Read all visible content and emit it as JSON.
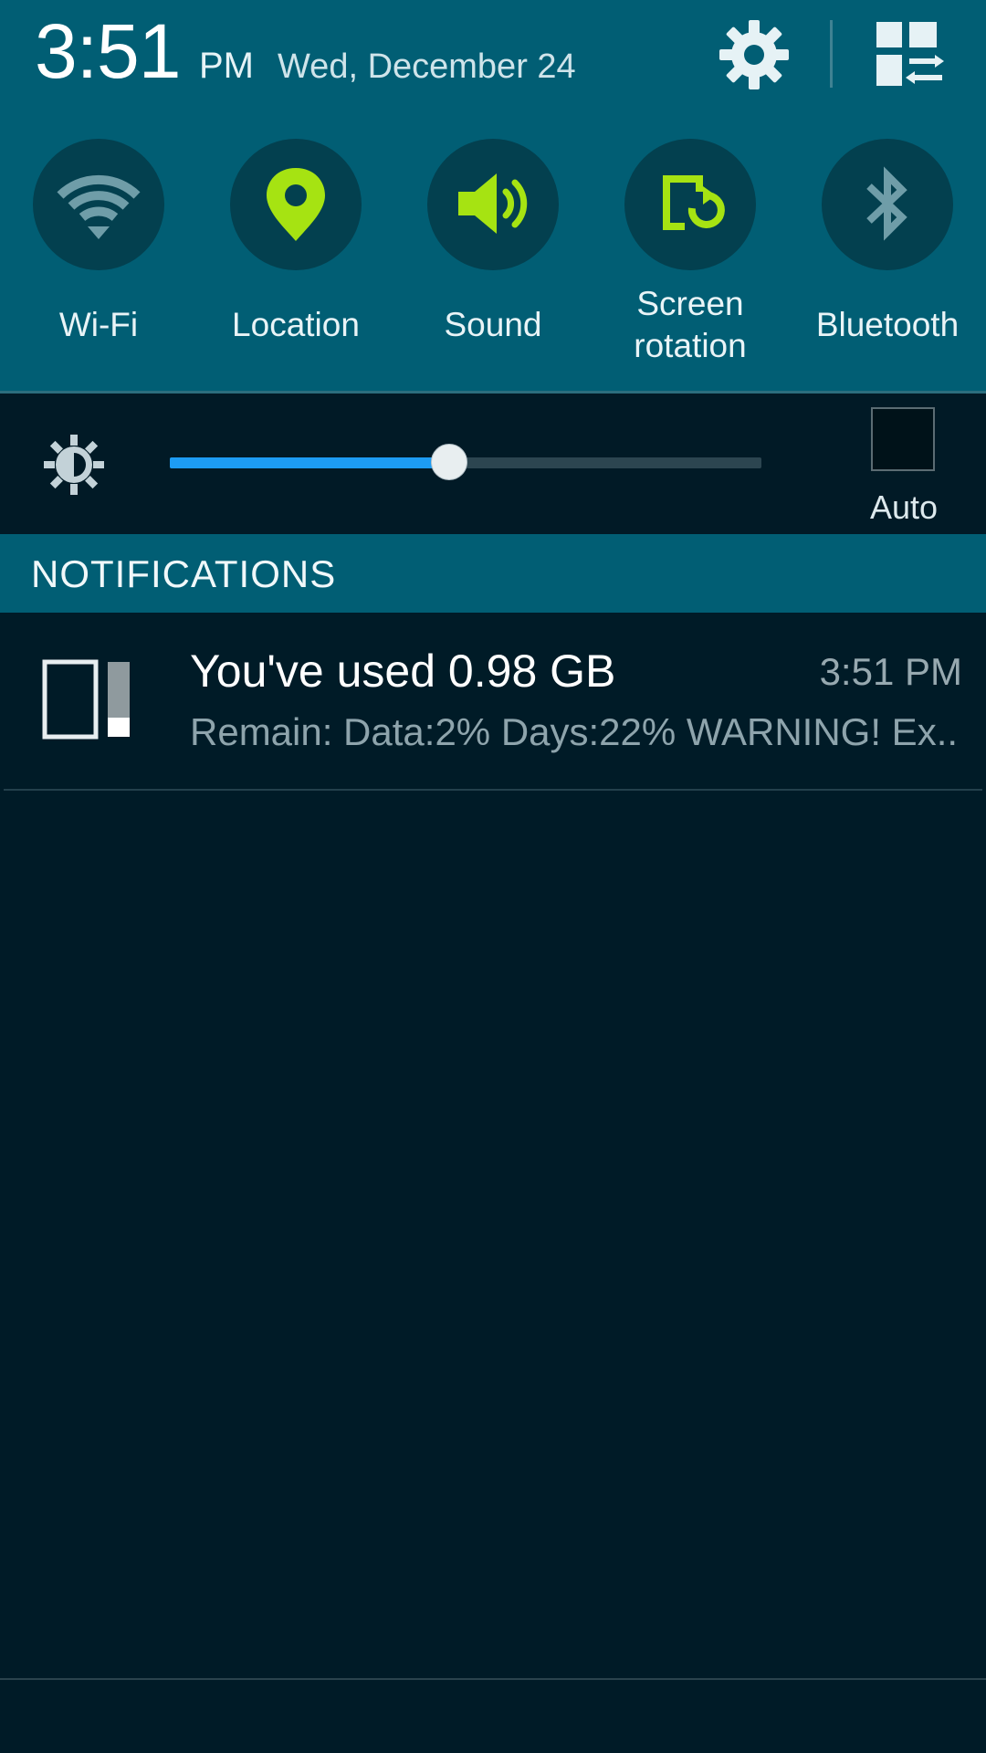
{
  "status": {
    "time": "3:51",
    "ampm": "PM",
    "date": "Wed, December 24"
  },
  "colors": {
    "header_bg": "#015e74",
    "panel_bg": "#001b27",
    "active_icon": "#a6e312",
    "inactive_icon": "#6f9da8",
    "slider_fill": "#1d9cf3"
  },
  "quick_settings": [
    {
      "label": "Wi-Fi",
      "icon": "wifi-icon",
      "active": false
    },
    {
      "label": "Location",
      "icon": "location-pin-icon",
      "active": true
    },
    {
      "label": "Sound",
      "icon": "speaker-icon",
      "active": true
    },
    {
      "label_line1": "Screen",
      "label_line2": "rotation",
      "icon": "screen-rotation-icon",
      "active": true
    },
    {
      "label": "Bluetooth",
      "icon": "bluetooth-icon",
      "active": false
    }
  ],
  "brightness": {
    "level": 0.47,
    "auto_label": "Auto",
    "auto_checked": false
  },
  "notifications": {
    "header": "NOTIFICATIONS",
    "items": [
      {
        "title": "You've used 0.98 GB",
        "time": "3:51 PM",
        "body": "Remain: Data:2% Days:22% WARNING! Ex..",
        "icon": "data-usage-icon"
      }
    ]
  }
}
